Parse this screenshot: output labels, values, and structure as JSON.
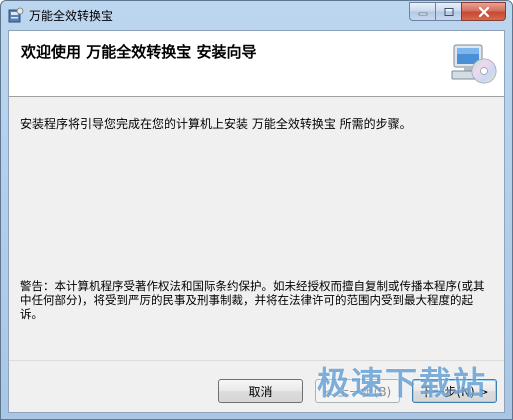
{
  "window": {
    "title": "万能全效转换宝",
    "controls": {
      "minimize": "minimize-icon",
      "maximize": "maximize-icon",
      "close": "close-icon"
    }
  },
  "wizard": {
    "title": "欢迎使用 万能全效转换宝 安装向导",
    "intro": "安装程序将引导您完成在您的计算机上安装 万能全效转换宝 所需的步骤。",
    "warning": "警告：本计算机程序受著作权法和国际条约保护。如未经授权而擅自复制或传播本程序(或其中任何部分)，将受到严厉的民事及刑事制裁，并将在法律许可的范围内受到最大程度的起诉。"
  },
  "buttons": {
    "cancel": "取消",
    "back": "< 上一步(B)",
    "next": "下一步(N) >"
  },
  "watermark": "极速下载站",
  "colors": {
    "frame": "#bcd6ef",
    "close_button": "#c44a33",
    "dialog_bg": "#f0f0f0",
    "watermark": "#146ebe"
  }
}
